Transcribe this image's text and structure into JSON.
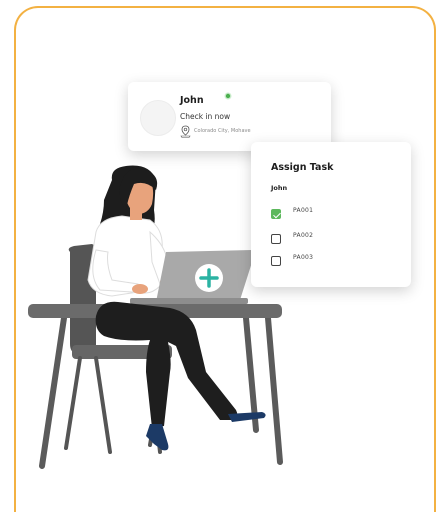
{
  "checkin": {
    "name": "John",
    "status": "Check in now",
    "location": "Colorado City, Mohave",
    "online_color": "#4caf50"
  },
  "task_panel": {
    "title": "Assign Task",
    "user": "John",
    "items": [
      {
        "label": "PA001",
        "checked": true
      },
      {
        "label": "PA002",
        "checked": false
      },
      {
        "label": "PA003",
        "checked": false
      }
    ]
  },
  "icons": [
    "location-pin-icon",
    "plus-icon",
    "checkmark-icon"
  ],
  "colors": {
    "frame_border": "#f3b142",
    "plus_accent": "#2bb3a3",
    "check_green": "#5cb85c"
  }
}
